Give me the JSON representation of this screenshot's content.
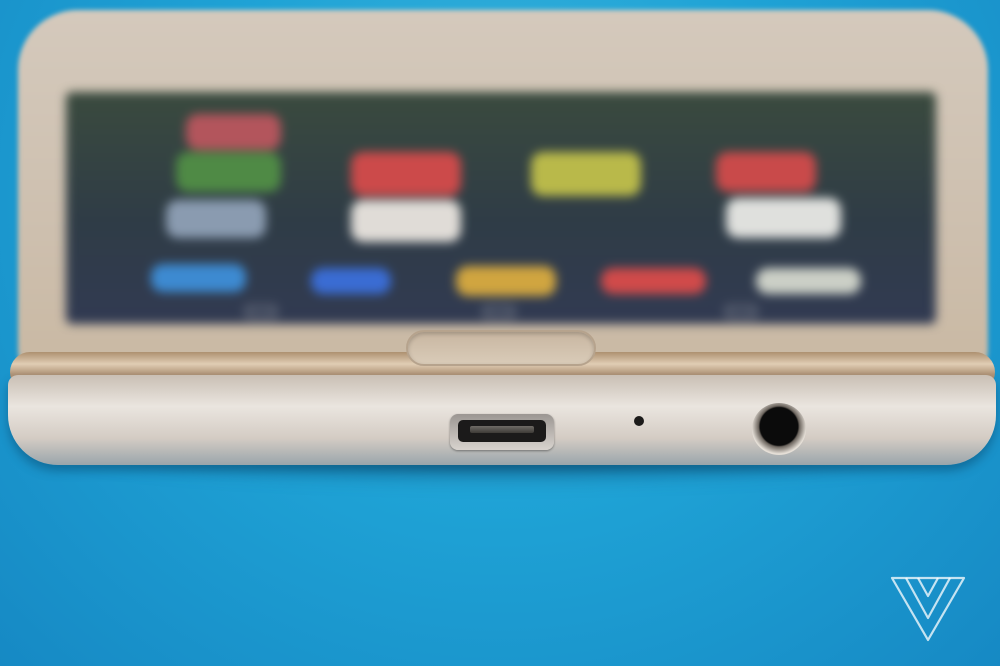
{
  "image": {
    "subject": "smartphone-bottom-edge-closeup",
    "background_color": "#1fa3d6",
    "phone_color": "#d3c6b5",
    "trim_color": "#b8997b"
  },
  "screen": {
    "app_icons": [
      {
        "color": "#b3555c"
      },
      {
        "color": "#cc4a4a"
      },
      {
        "color": "#b9b94a"
      },
      {
        "color": "#c94a4a"
      },
      {
        "color": "#4f8a45"
      },
      {
        "color": "#e0dcd7"
      },
      {
        "color": "#dfe0dd"
      },
      {
        "color": "#8a9bb0"
      },
      {
        "color": "#3d8ad1"
      },
      {
        "color": "#3a6cd3"
      },
      {
        "color": "#d0a540"
      },
      {
        "color": "#d04a4a"
      },
      {
        "color": "#cbcfc6"
      }
    ]
  },
  "icons": {
    "watermark": "verge-triangle-icon",
    "usb": "micro-usb-port-icon",
    "jack": "headphone-jack-icon"
  }
}
